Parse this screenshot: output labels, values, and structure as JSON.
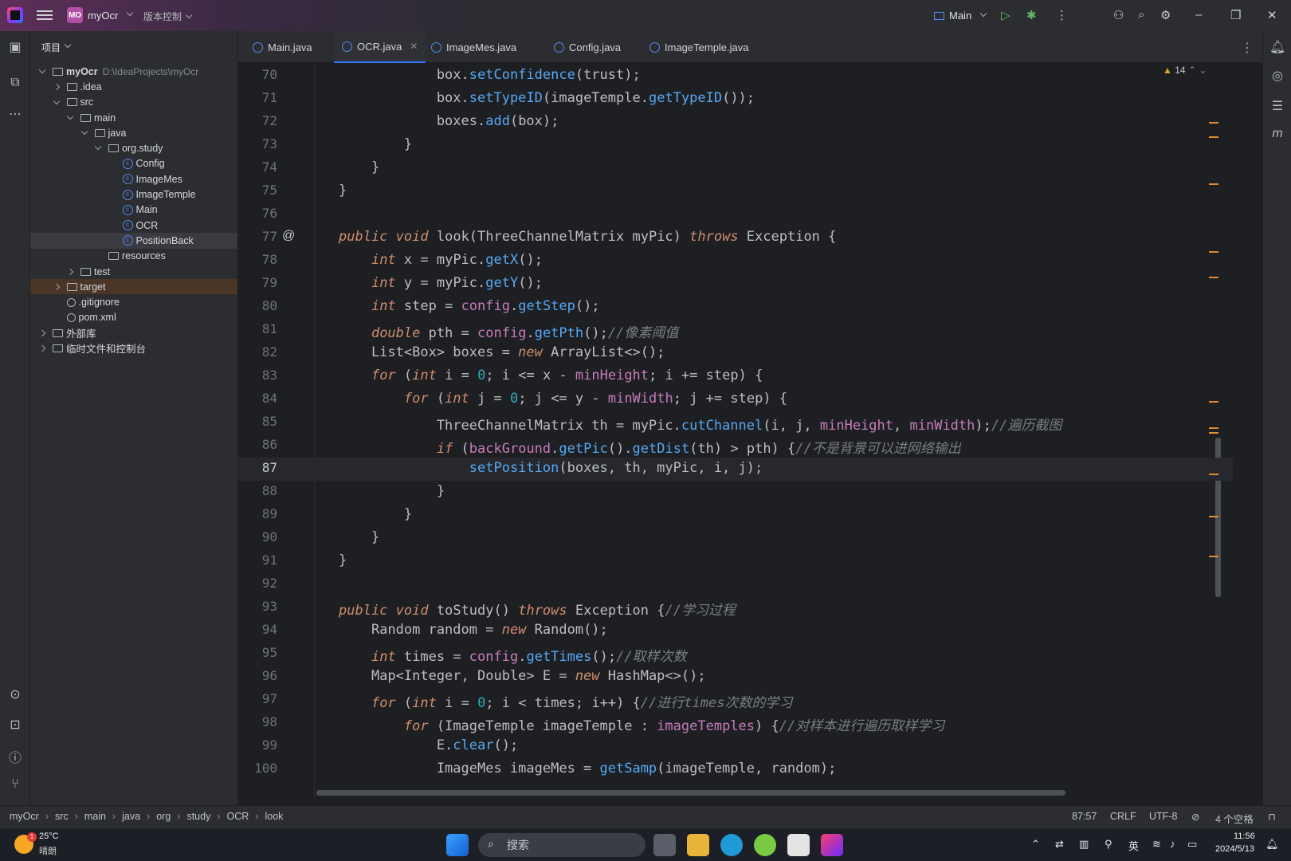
{
  "titlebar": {
    "project_badge": "MO",
    "project_name": "myOcr",
    "vcs_label": "版本控制",
    "run_config": "Main"
  },
  "project_panel": {
    "header": "项目",
    "tree": [
      {
        "label": "myOcr",
        "path": "D:\\IdeaProjects\\myOcr",
        "depth": 0,
        "state": "open",
        "kind": "folder"
      },
      {
        "label": ".idea",
        "depth": 1,
        "state": "closed",
        "kind": "folder"
      },
      {
        "label": "src",
        "depth": 1,
        "state": "open",
        "kind": "folder"
      },
      {
        "label": "main",
        "depth": 2,
        "state": "open",
        "kind": "folder"
      },
      {
        "label": "java",
        "depth": 3,
        "state": "open",
        "kind": "folder"
      },
      {
        "label": "org.study",
        "depth": 4,
        "state": "open",
        "kind": "folder"
      },
      {
        "label": "Config",
        "depth": 5,
        "kind": "class"
      },
      {
        "label": "ImageMes",
        "depth": 5,
        "kind": "class"
      },
      {
        "label": "ImageTemple",
        "depth": 5,
        "kind": "class"
      },
      {
        "label": "Main",
        "depth": 5,
        "kind": "class"
      },
      {
        "label": "OCR",
        "depth": 5,
        "kind": "class"
      },
      {
        "label": "PositionBack",
        "depth": 5,
        "kind": "class",
        "selected": true
      },
      {
        "label": "resources",
        "depth": 4,
        "kind": "folder"
      },
      {
        "label": "test",
        "depth": 2,
        "state": "closed",
        "kind": "folder"
      },
      {
        "label": "target",
        "depth": 1,
        "state": "closed",
        "kind": "folder",
        "highlight": true
      },
      {
        "label": ".gitignore",
        "depth": 1,
        "kind": "file"
      },
      {
        "label": "pom.xml",
        "depth": 1,
        "kind": "file"
      },
      {
        "label": "外部库",
        "depth": 0,
        "state": "closed",
        "kind": "lib"
      },
      {
        "label": "临时文件和控制台",
        "depth": 0,
        "state": "closed",
        "kind": "lib"
      }
    ]
  },
  "tabs": [
    {
      "label": "Main.java",
      "active": false
    },
    {
      "label": "OCR.java",
      "active": true
    },
    {
      "label": "ImageMes.java",
      "active": false
    },
    {
      "label": "Config.java",
      "active": false
    },
    {
      "label": "ImageTemple.java",
      "active": false
    }
  ],
  "editor": {
    "warning_count": "14",
    "current_line": 87,
    "lines": [
      {
        "n": "70",
        "t": "            box.setConfidence(trust);"
      },
      {
        "n": "71",
        "t": "            box.setTypeID(imageTemple.getTypeID());"
      },
      {
        "n": "72",
        "t": "            boxes.add(box);"
      },
      {
        "n": "73",
        "t": "        }"
      },
      {
        "n": "74",
        "t": "    }"
      },
      {
        "n": "75",
        "t": "}"
      },
      {
        "n": "76",
        "t": ""
      },
      {
        "n": "77",
        "t": "public void look(ThreeChannelMatrix myPic) throws Exception {"
      },
      {
        "n": "78",
        "t": "    int x = myPic.getX();"
      },
      {
        "n": "79",
        "t": "    int y = myPic.getY();"
      },
      {
        "n": "80",
        "t": "    int step = config.getStep();"
      },
      {
        "n": "81",
        "t": "    double pth = config.getPth();//像素阈值"
      },
      {
        "n": "82",
        "t": "    List<Box> boxes = new ArrayList<>();"
      },
      {
        "n": "83",
        "t": "    for (int i = 0; i <= x - minHeight; i += step) {"
      },
      {
        "n": "84",
        "t": "        for (int j = 0; j <= y - minWidth; j += step) {"
      },
      {
        "n": "85",
        "t": "            ThreeChannelMatrix th = myPic.cutChannel(i, j, minHeight, minWidth);//遍历截图"
      },
      {
        "n": "86",
        "t": "            if (backGround.getPic().getDist(th) > pth) {//不是背景可以进网络输出"
      },
      {
        "n": "87",
        "t": "                setPosition(boxes, th, myPic, i, j);"
      },
      {
        "n": "88",
        "t": "            }"
      },
      {
        "n": "89",
        "t": "        }"
      },
      {
        "n": "90",
        "t": "    }"
      },
      {
        "n": "91",
        "t": "}"
      },
      {
        "n": "92",
        "t": ""
      },
      {
        "n": "93",
        "t": "public void toStudy() throws Exception {//学习过程"
      },
      {
        "n": "94",
        "t": "    Random random = new Random();"
      },
      {
        "n": "95",
        "t": "    int times = config.getTimes();//取样次数"
      },
      {
        "n": "96",
        "t": "    Map<Integer, Double> E = new HashMap<>();"
      },
      {
        "n": "97",
        "t": "    for (int i = 0; i < times; i++) {//进行times次数的学习"
      },
      {
        "n": "98",
        "t": "        for (ImageTemple imageTemple : imageTemples) {//对样本进行遍历取样学习"
      },
      {
        "n": "99",
        "t": "            E.clear();"
      },
      {
        "n": "100",
        "t": "            ImageMes imageMes = getSamp(imageTemple, random);"
      }
    ]
  },
  "statusbar": {
    "breadcrumb": [
      "myOcr",
      "src",
      "main",
      "java",
      "org",
      "study",
      "OCR",
      "look"
    ],
    "position": "87:57",
    "line_sep": "CRLF",
    "encoding": "UTF-8",
    "indent": "4 个空格"
  },
  "taskbar": {
    "weather_temp": "25°C",
    "weather_desc": "晴朗",
    "search_placeholder": "搜索",
    "ime": "英",
    "time": "11:56",
    "date": "2024/5/13",
    "notif_count": "1"
  }
}
